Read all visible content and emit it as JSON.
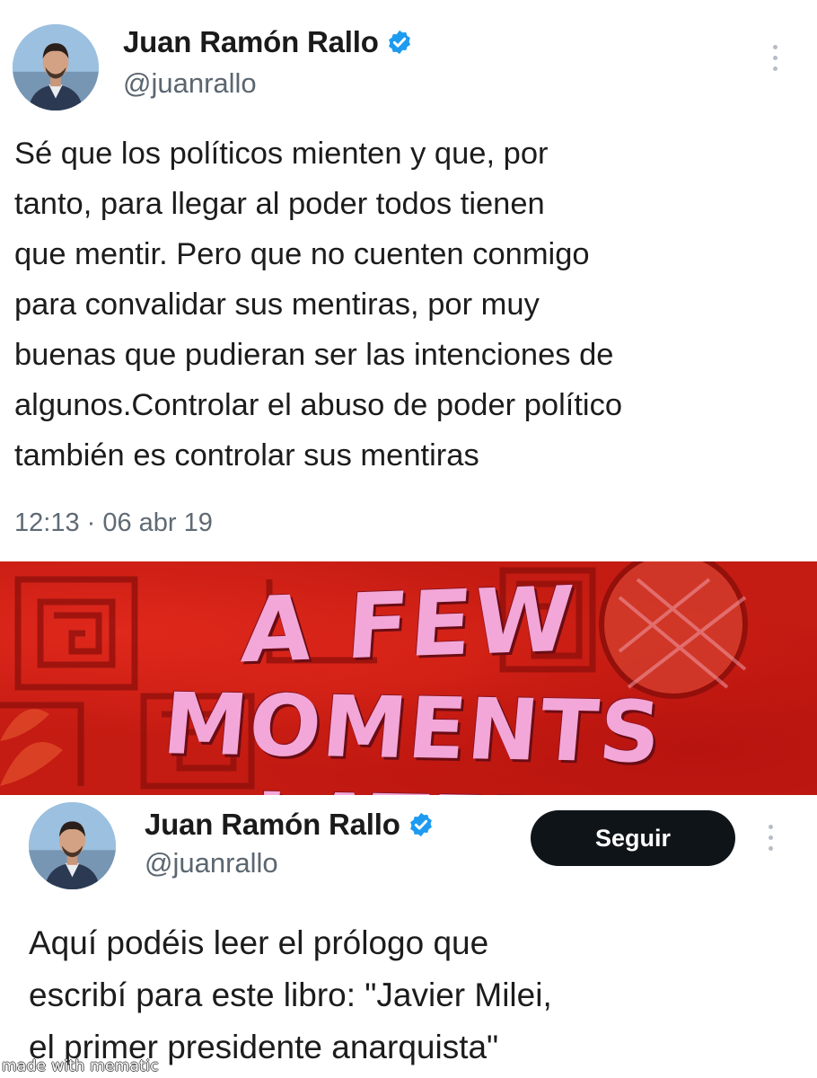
{
  "tweet1": {
    "avatar_icon": "profile-photo",
    "display_name": "Juan Ramón Rallo",
    "verified_icon": "verified-badge-icon",
    "handle": "@juanrallo",
    "more_icon": "vertical-ellipsis-icon",
    "body": "Sé que los políticos mienten y que, por\ntanto, para llegar al poder todos tienen\nque mentir. Pero que no cuenten conmigo\npara convalidar sus mentiras, por muy\nbuenas que pudieran ser las intenciones de\nalgunos.Controlar el abuso de poder político\ntambién es controlar sus mentiras",
    "timestamp": "12:13 · 06 abr 19"
  },
  "banner": {
    "line1": "A FEW",
    "line2": "MOMENTS LATER",
    "text_color": "#f3a7d8",
    "background_color": "#c41b12"
  },
  "tweet2": {
    "avatar_icon": "profile-photo",
    "display_name": "Juan Ramón Rallo",
    "verified_icon": "verified-badge-icon",
    "handle": "@juanrallo",
    "follow_label": "Seguir",
    "more_icon": "vertical-ellipsis-icon",
    "body": "Aquí podéis leer el prólogo que\nescribí para este libro: \"Javier Milei,\nel primer presidente anarquista\""
  },
  "watermark": "made with mematic",
  "colors": {
    "verified_blue": "#1d9bf0",
    "handle_gray": "#5b6670",
    "follow_button": "#0f1419"
  }
}
